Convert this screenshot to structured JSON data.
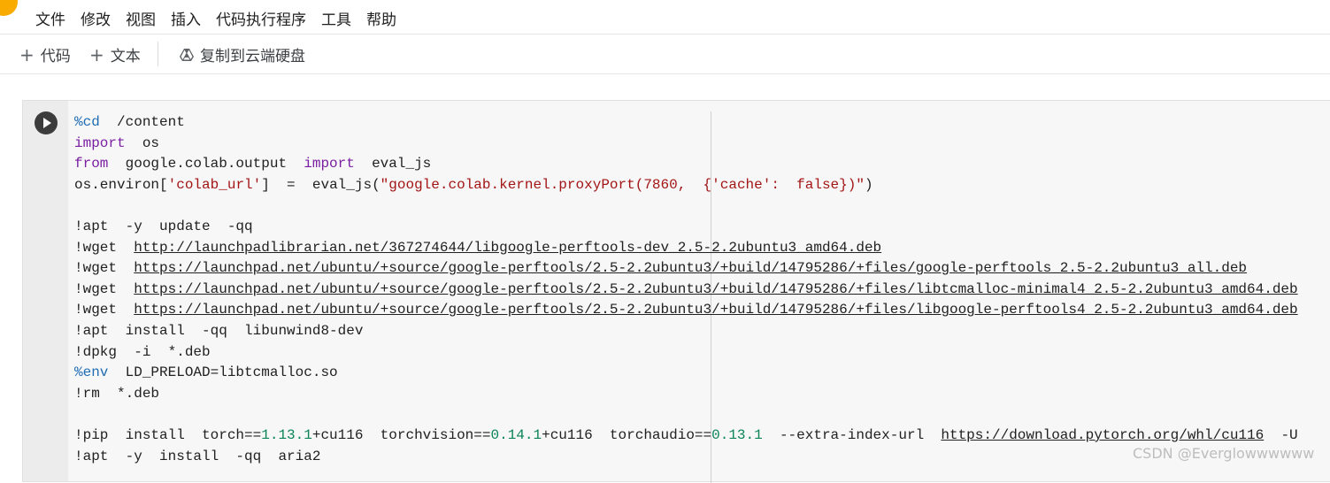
{
  "menubar": {
    "items": [
      "文件",
      "修改",
      "视图",
      "插入",
      "代码执行程序",
      "工具",
      "帮助"
    ]
  },
  "toolbar": {
    "code_btn": "代码",
    "text_btn": "文本",
    "copy_drive": "复制到云端硬盘"
  },
  "code_lines": [
    [
      {
        "t": "%cd",
        "c": "mg"
      },
      {
        "t": "  /content"
      }
    ],
    [
      {
        "t": "import",
        "c": "kw"
      },
      {
        "t": "  os"
      }
    ],
    [
      {
        "t": "from",
        "c": "kw"
      },
      {
        "t": "  google.colab.output  "
      },
      {
        "t": "import",
        "c": "kw"
      },
      {
        "t": "  eval_js"
      }
    ],
    [
      {
        "t": "os.environ["
      },
      {
        "t": "'colab_url'",
        "c": "st"
      },
      {
        "t": "]  =  eval_js("
      },
      {
        "t": "\"google.colab.kernel.proxyPort(7860,  {'cache':  false})\"",
        "c": "st"
      },
      {
        "t": ")"
      }
    ],
    [],
    [
      {
        "t": "!apt  -y  update  -qq"
      }
    ],
    [
      {
        "t": "!wget  "
      },
      {
        "t": "http://launchpadlibrarian.net/367274644/libgoogle-perftools-dev_2.5-2.2ubuntu3_amd64.deb",
        "u": 1
      }
    ],
    [
      {
        "t": "!wget  "
      },
      {
        "t": "https://launchpad.net/ubuntu/+source/google-perftools/2.5-2.2ubuntu3/+build/14795286/+files/google-perftools_2.5-2.2ubuntu3_all.deb",
        "u": 1
      }
    ],
    [
      {
        "t": "!wget  "
      },
      {
        "t": "https://launchpad.net/ubuntu/+source/google-perftools/2.5-2.2ubuntu3/+build/14795286/+files/libtcmalloc-minimal4_2.5-2.2ubuntu3_amd64.deb",
        "u": 1
      }
    ],
    [
      {
        "t": "!wget  "
      },
      {
        "t": "https://launchpad.net/ubuntu/+source/google-perftools/2.5-2.2ubuntu3/+build/14795286/+files/libgoogle-perftools4_2.5-2.2ubuntu3_amd64.deb",
        "u": 1
      }
    ],
    [
      {
        "t": "!apt  install  -qq  libunwind8-dev"
      }
    ],
    [
      {
        "t": "!dpkg  -i  *.deb"
      }
    ],
    [
      {
        "t": "%env",
        "c": "mg"
      },
      {
        "t": "  LD_PRELOAD=libtcmalloc.so"
      }
    ],
    [
      {
        "t": "!rm  *.deb"
      }
    ],
    [],
    [
      {
        "t": "!pip  install  torch=="
      },
      {
        "t": "1.13.1",
        "c": "nm"
      },
      {
        "t": "+cu116  torchvision=="
      },
      {
        "t": "0.14.1",
        "c": "nm"
      },
      {
        "t": "+cu116  torchaudio=="
      },
      {
        "t": "0.13.1",
        "c": "nm"
      },
      {
        "t": "  --extra-index-url  "
      },
      {
        "t": "https://download.pytorch.org/whl/cu116",
        "u": 1
      },
      {
        "t": "  -U"
      }
    ],
    [
      {
        "t": "!apt  -y  install  -qq  aria2"
      }
    ]
  ],
  "watermark": "CSDN @Everglowwwwww"
}
